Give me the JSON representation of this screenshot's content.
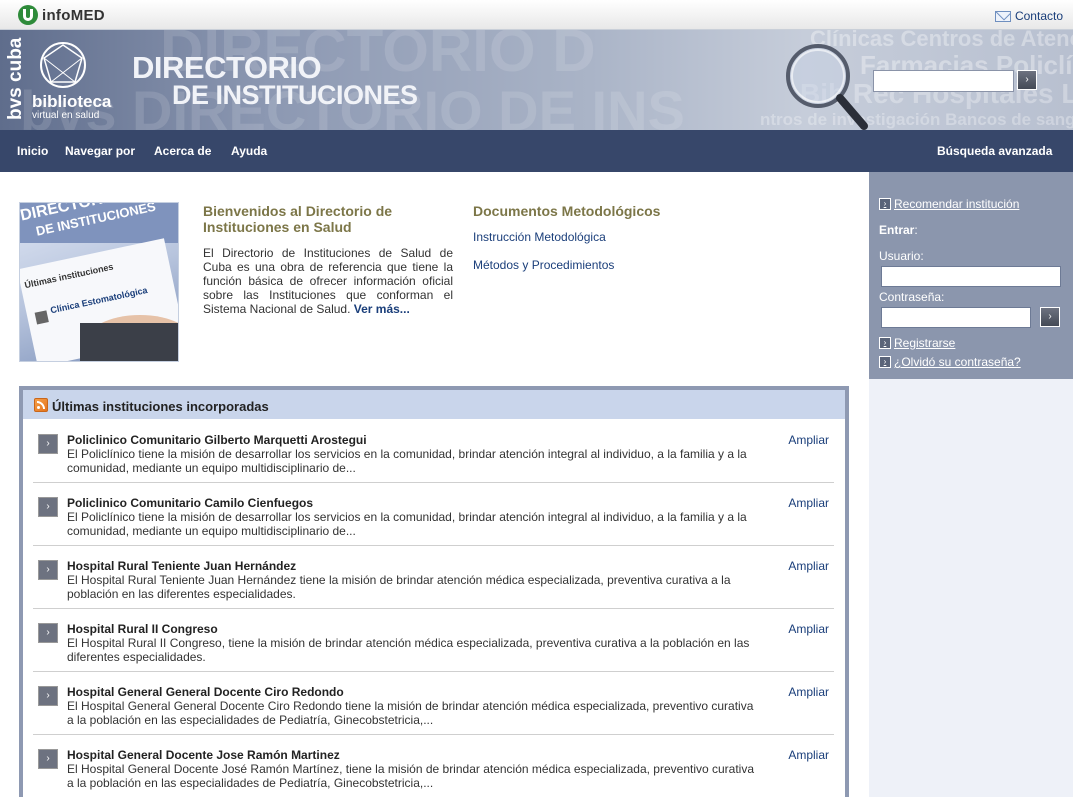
{
  "topbar": {
    "logo_text": "infoMED",
    "contact_label": "Contacto"
  },
  "banner": {
    "bvs_text": "bvs cuba",
    "biblioteca": "biblioteca",
    "virtual": "virtual en salud",
    "title_line1": "DIRECTORIO",
    "title_line2": "DE INSTITUCIONES",
    "search_placeholder": "",
    "search_button": "›"
  },
  "nav": {
    "items": [
      "Inicio",
      "Navegar por",
      "Acerca de",
      "Ayuda"
    ],
    "advanced": "Búsqueda avanzada"
  },
  "intro": {
    "welcome_title": "Bienvenidos al Directorio de Instituciones en Salud",
    "welcome_text": "El Directorio de Instituciones de Salud de Cuba es una obra de referencia que tiene la función básica de ofrecer información oficial sobre las Instituciones que conforman el Sistema Nacional de Salud.",
    "more": "Ver más...",
    "docs_title": "Documentos Metodológicos",
    "docs": [
      "Instrucción Metodológica",
      "Métodos y Procedimientos"
    ]
  },
  "sidebar": {
    "recommend": "Recomendar institución",
    "enter": "Entrar",
    "user_label": "Usuario:",
    "password_label": "Contraseña:",
    "submit": "›",
    "register": "Registrarse",
    "forgot": "¿Olvidó su contraseña?"
  },
  "latest": {
    "title": "Últimas instituciones incorporadas",
    "action": "Ampliar",
    "items": [
      {
        "name": "Policlinico Comunitario Gilberto Marquetti Arostegui",
        "desc": "El Policlínico tiene la misión de desarrollar los servicios en la comunidad, brindar atención integral al individuo, a la familia y a la comunidad, mediante un equipo multidisciplinario de..."
      },
      {
        "name": "Policlinico Comunitario Camilo Cienfuegos",
        "desc": "El Policlínico tiene la misión de desarrollar los servicios en la comunidad, brindar atención integral al individuo, a la familia y a la comunidad, mediante un equipo multidisciplinario de..."
      },
      {
        "name": "Hospital Rural Teniente Juan Hernández",
        "desc": "El Hospital Rural Teniente Juan Hernández tiene la misión de brindar atención médica especializada, preventiva curativa a la población en las diferentes especialidades."
      },
      {
        "name": "Hospital Rural II Congreso",
        "desc": "El Hospital Rural II Congreso, tiene la misión de brindar atención médica especializada, preventiva curativa a la población en las diferentes especialidades."
      },
      {
        "name": "Hospital General General Docente Ciro Redondo",
        "desc": "El Hospital General General Docente Ciro Redondo tiene la misión de brindar atención médica especializada, preventivo curativa a la población en las especialidades de Pediatría, Ginecobstetricia,..."
      },
      {
        "name": "Hospital General Docente Jose Ramón Martinez",
        "desc": "El Hospital General Docente José Ramón Martínez, tiene la misión de brindar atención médica especializada, preventivo curativa a la población en las especialidades de Pediatría, Ginecobstetricia,..."
      }
    ]
  }
}
